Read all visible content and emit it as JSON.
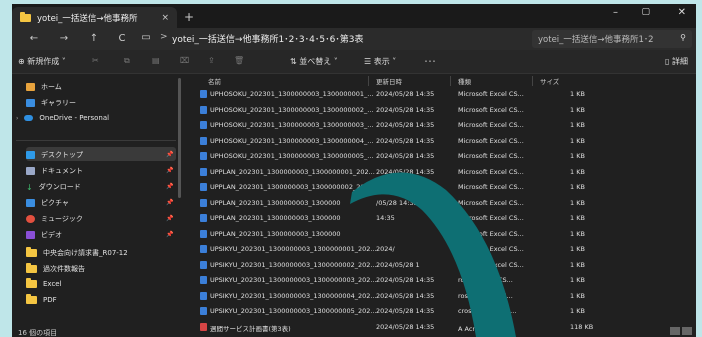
{
  "tab": {
    "title": "yotei_一括送信→他事務所",
    "close": "×",
    "add": "+"
  },
  "window_controls": {
    "minimize": "–",
    "maximize": "▢",
    "close": "✕"
  },
  "nav": {
    "back": "←",
    "forward": "→",
    "up": "↑",
    "refresh": "C",
    "monitor": "▭",
    "chevron": ">"
  },
  "address": {
    "path": "yotei_一括送信→他事務所1･2･3･4･5･6･第3表",
    "search_placeholder": "yotei_一括送信→他事務所1･2"
  },
  "toolbar": {
    "new_label": "新規作成",
    "sort_label": "並べ替え",
    "view_label": "表示",
    "more_label": "･･･",
    "details_label": "詳細"
  },
  "sidebar": {
    "top_items": [
      {
        "label": "ホーム",
        "icon": "home-icon"
      },
      {
        "label": "ギャラリー",
        "icon": "gallery-icon"
      },
      {
        "label": "OneDrive - Personal",
        "icon": "cloud-icon"
      }
    ],
    "quick_items": [
      {
        "label": "デスクトップ",
        "icon": "desktop-icon"
      },
      {
        "label": "ドキュメント",
        "icon": "document-icon"
      },
      {
        "label": "ダウンロード",
        "icon": "download-icon"
      },
      {
        "label": "ピクチャ",
        "icon": "pictures-icon"
      },
      {
        "label": "ミュージック",
        "icon": "music-icon"
      },
      {
        "label": "ビデオ",
        "icon": "video-icon"
      }
    ],
    "folders": [
      {
        "label": "中央会向け請求書_R07-12",
        "icon": "folder-icon"
      },
      {
        "label": "過次件数報告",
        "icon": "folder-icon"
      },
      {
        "label": "Excel",
        "icon": "folder-icon"
      },
      {
        "label": "PDF",
        "icon": "folder-icon"
      }
    ],
    "status": "16 個の項目"
  },
  "columns": {
    "name": "名前",
    "date": "更新日時",
    "type": "種類",
    "size": "サイズ"
  },
  "files": [
    {
      "name": "UPHOSOKU_202301_1300000003_1300000001_...",
      "date": "2024/05/28 14:35",
      "type": "Microsoft Excel CS...",
      "size": "1 KB"
    },
    {
      "name": "UPHOSOKU_202301_1300000003_1300000002_...",
      "date": "2024/05/28 14:35",
      "type": "Microsoft Excel CS...",
      "size": "1 KB"
    },
    {
      "name": "UPHOSOKU_202301_1300000003_1300000003_...",
      "date": "2024/05/28 14:35",
      "type": "Microsoft Excel CS...",
      "size": "1 KB"
    },
    {
      "name": "UPHOSOKU_202301_1300000003_1300000004_...",
      "date": "2024/05/28 14:35",
      "type": "Microsoft Excel CS...",
      "size": "1 KB"
    },
    {
      "name": "UPHOSOKU_202301_1300000003_1300000005_...",
      "date": "2024/05/28 14:35",
      "type": "Microsoft Excel CS...",
      "size": "1 KB"
    },
    {
      "name": "UPPLAN_202301_1300000003_1300000001_202...",
      "date": "2024/05/28 14:35",
      "type": "Microsoft Excel CS...",
      "size": "1 KB"
    },
    {
      "name": "UPPLAN_202301_1300000003_1300000002_202...",
      "date": "2024/05/28 14:35",
      "type": "Microsoft Excel CS...",
      "size": "1 KB"
    },
    {
      "name": "UPPLAN_202301_1300000003_1300000",
      "date": "/05/28 14:35",
      "type": "Microsoft Excel CS...",
      "size": "1 KB"
    },
    {
      "name": "UPPLAN_202301_1300000003_1300000",
      "date": "14:35",
      "type": "Microsoft Excel CS...",
      "size": "1 KB"
    },
    {
      "name": "UPPLAN_202301_1300000003_1300000",
      "date": "",
      "type": "Microsoft Excel CS...",
      "size": "1 KB"
    },
    {
      "name": "UPSIKYU_202301_1300000003_1300000001_202...",
      "date": "2024/",
      "type": "Microsoft Excel CS...",
      "size": "1 KB"
    },
    {
      "name": "UPSIKYU_202301_1300000003_1300000002_202...",
      "date": "2024/05/28 1",
      "type": "Microsoft Excel CS...",
      "size": "1 KB"
    },
    {
      "name": "UPSIKYU_202301_1300000003_1300000003_202...",
      "date": "2024/05/28 14:35",
      "type": "rosoft Excel CS...",
      "size": "1 KB"
    },
    {
      "name": "UPSIKYU_202301_1300000003_1300000004_202...",
      "date": "2024/05/28 14:35",
      "type": "rosoft Excel CS...",
      "size": "1 KB"
    },
    {
      "name": "UPSIKYU_202301_1300000003_1300000005_202...",
      "date": "2024/05/28 14:35",
      "type": "crosoft Excel CS...",
      "size": "1 KB"
    },
    {
      "name": "週間サービス計画書(第3表)",
      "date": "2024/05/28 14:35",
      "type": "A    Acroba 文書",
      "size": "118 KB",
      "pdf": true
    }
  ],
  "colors": {
    "arrow": "#0e6f73",
    "background": "#bfe6e9",
    "window": "#202020"
  }
}
